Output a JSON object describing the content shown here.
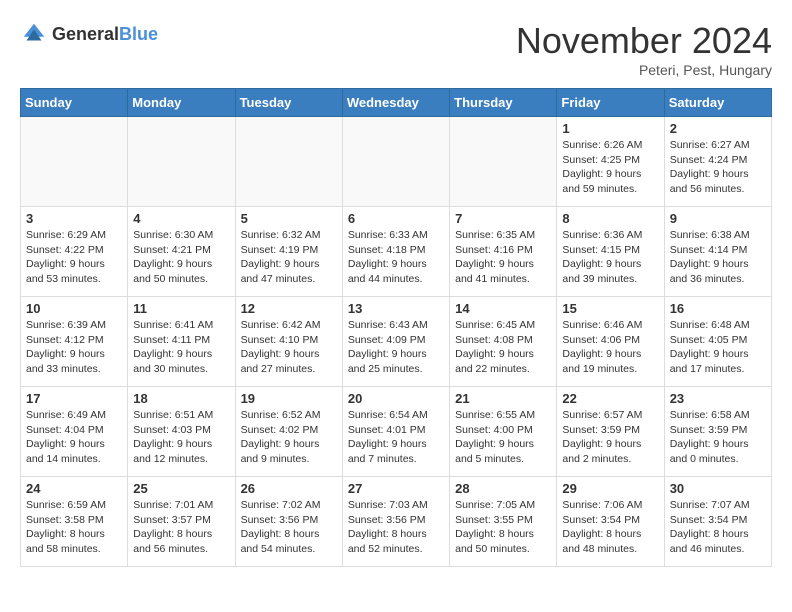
{
  "logo": {
    "general": "General",
    "blue": "Blue"
  },
  "header": {
    "month": "November 2024",
    "location": "Peteri, Pest, Hungary"
  },
  "weekdays": [
    "Sunday",
    "Monday",
    "Tuesday",
    "Wednesday",
    "Thursday",
    "Friday",
    "Saturday"
  ],
  "weeks": [
    [
      {
        "day": "",
        "info": ""
      },
      {
        "day": "",
        "info": ""
      },
      {
        "day": "",
        "info": ""
      },
      {
        "day": "",
        "info": ""
      },
      {
        "day": "",
        "info": ""
      },
      {
        "day": "1",
        "info": "Sunrise: 6:26 AM\nSunset: 4:25 PM\nDaylight: 9 hours\nand 59 minutes."
      },
      {
        "day": "2",
        "info": "Sunrise: 6:27 AM\nSunset: 4:24 PM\nDaylight: 9 hours\nand 56 minutes."
      }
    ],
    [
      {
        "day": "3",
        "info": "Sunrise: 6:29 AM\nSunset: 4:22 PM\nDaylight: 9 hours\nand 53 minutes."
      },
      {
        "day": "4",
        "info": "Sunrise: 6:30 AM\nSunset: 4:21 PM\nDaylight: 9 hours\nand 50 minutes."
      },
      {
        "day": "5",
        "info": "Sunrise: 6:32 AM\nSunset: 4:19 PM\nDaylight: 9 hours\nand 47 minutes."
      },
      {
        "day": "6",
        "info": "Sunrise: 6:33 AM\nSunset: 4:18 PM\nDaylight: 9 hours\nand 44 minutes."
      },
      {
        "day": "7",
        "info": "Sunrise: 6:35 AM\nSunset: 4:16 PM\nDaylight: 9 hours\nand 41 minutes."
      },
      {
        "day": "8",
        "info": "Sunrise: 6:36 AM\nSunset: 4:15 PM\nDaylight: 9 hours\nand 39 minutes."
      },
      {
        "day": "9",
        "info": "Sunrise: 6:38 AM\nSunset: 4:14 PM\nDaylight: 9 hours\nand 36 minutes."
      }
    ],
    [
      {
        "day": "10",
        "info": "Sunrise: 6:39 AM\nSunset: 4:12 PM\nDaylight: 9 hours\nand 33 minutes."
      },
      {
        "day": "11",
        "info": "Sunrise: 6:41 AM\nSunset: 4:11 PM\nDaylight: 9 hours\nand 30 minutes."
      },
      {
        "day": "12",
        "info": "Sunrise: 6:42 AM\nSunset: 4:10 PM\nDaylight: 9 hours\nand 27 minutes."
      },
      {
        "day": "13",
        "info": "Sunrise: 6:43 AM\nSunset: 4:09 PM\nDaylight: 9 hours\nand 25 minutes."
      },
      {
        "day": "14",
        "info": "Sunrise: 6:45 AM\nSunset: 4:08 PM\nDaylight: 9 hours\nand 22 minutes."
      },
      {
        "day": "15",
        "info": "Sunrise: 6:46 AM\nSunset: 4:06 PM\nDaylight: 9 hours\nand 19 minutes."
      },
      {
        "day": "16",
        "info": "Sunrise: 6:48 AM\nSunset: 4:05 PM\nDaylight: 9 hours\nand 17 minutes."
      }
    ],
    [
      {
        "day": "17",
        "info": "Sunrise: 6:49 AM\nSunset: 4:04 PM\nDaylight: 9 hours\nand 14 minutes."
      },
      {
        "day": "18",
        "info": "Sunrise: 6:51 AM\nSunset: 4:03 PM\nDaylight: 9 hours\nand 12 minutes."
      },
      {
        "day": "19",
        "info": "Sunrise: 6:52 AM\nSunset: 4:02 PM\nDaylight: 9 hours\nand 9 minutes."
      },
      {
        "day": "20",
        "info": "Sunrise: 6:54 AM\nSunset: 4:01 PM\nDaylight: 9 hours\nand 7 minutes."
      },
      {
        "day": "21",
        "info": "Sunrise: 6:55 AM\nSunset: 4:00 PM\nDaylight: 9 hours\nand 5 minutes."
      },
      {
        "day": "22",
        "info": "Sunrise: 6:57 AM\nSunset: 3:59 PM\nDaylight: 9 hours\nand 2 minutes."
      },
      {
        "day": "23",
        "info": "Sunrise: 6:58 AM\nSunset: 3:59 PM\nDaylight: 9 hours\nand 0 minutes."
      }
    ],
    [
      {
        "day": "24",
        "info": "Sunrise: 6:59 AM\nSunset: 3:58 PM\nDaylight: 8 hours\nand 58 minutes."
      },
      {
        "day": "25",
        "info": "Sunrise: 7:01 AM\nSunset: 3:57 PM\nDaylight: 8 hours\nand 56 minutes."
      },
      {
        "day": "26",
        "info": "Sunrise: 7:02 AM\nSunset: 3:56 PM\nDaylight: 8 hours\nand 54 minutes."
      },
      {
        "day": "27",
        "info": "Sunrise: 7:03 AM\nSunset: 3:56 PM\nDaylight: 8 hours\nand 52 minutes."
      },
      {
        "day": "28",
        "info": "Sunrise: 7:05 AM\nSunset: 3:55 PM\nDaylight: 8 hours\nand 50 minutes."
      },
      {
        "day": "29",
        "info": "Sunrise: 7:06 AM\nSunset: 3:54 PM\nDaylight: 8 hours\nand 48 minutes."
      },
      {
        "day": "30",
        "info": "Sunrise: 7:07 AM\nSunset: 3:54 PM\nDaylight: 8 hours\nand 46 minutes."
      }
    ]
  ]
}
